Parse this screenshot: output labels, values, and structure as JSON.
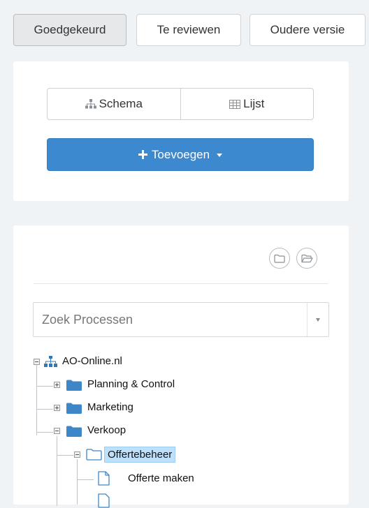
{
  "tabs": [
    {
      "label": "Goedgekeurd",
      "active": true
    },
    {
      "label": "Te reviewen",
      "active": false
    },
    {
      "label": "Oudere versie",
      "active": false
    }
  ],
  "view_toggle": {
    "schema_label": "Schema",
    "lijst_label": "Lijst"
  },
  "add_button": {
    "label": "Toevoegen"
  },
  "search": {
    "placeholder": "Zoek Processen"
  },
  "tree": {
    "root": "AO-Online.nl",
    "items": [
      {
        "label": "Planning & Control"
      },
      {
        "label": "Marketing"
      },
      {
        "label": "Verkoop"
      },
      {
        "label": "Offertebeheer"
      },
      {
        "label": "Offerte maken"
      }
    ]
  },
  "colors": {
    "primary": "#3d89cf",
    "folder": "#3d87c9",
    "selected_bg": "#bfe0fb"
  }
}
